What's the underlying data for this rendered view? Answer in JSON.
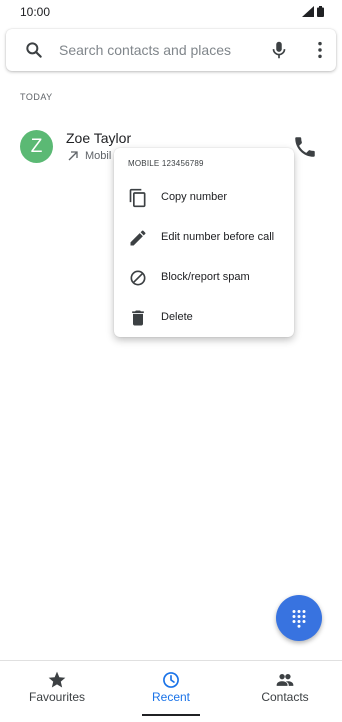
{
  "status_bar": {
    "time": "10:00"
  },
  "search": {
    "placeholder": "Search contacts and places"
  },
  "section": {
    "header": "TODAY"
  },
  "call_log": [
    {
      "avatar_letter": "Z",
      "name": "Zoe Taylor",
      "type": "Mobil",
      "avatar_color": "#5bb974"
    }
  ],
  "context_menu": {
    "header": "MOBILE 123456789",
    "items": [
      {
        "label": "Copy number",
        "icon": "copy-icon"
      },
      {
        "label": "Edit number before call",
        "icon": "pencil-icon"
      },
      {
        "label": "Block/report spam",
        "icon": "block-icon"
      },
      {
        "label": "Delete",
        "icon": "trash-icon"
      }
    ]
  },
  "bottom_nav": {
    "items": [
      {
        "label": "Favourites",
        "icon": "star-icon"
      },
      {
        "label": "Recent",
        "icon": "clock-icon",
        "active": true
      },
      {
        "label": "Contacts",
        "icon": "people-icon"
      }
    ]
  },
  "colors": {
    "accent": "#1a73e8",
    "fab": "#3873e0",
    "avatar": "#5bb974"
  }
}
